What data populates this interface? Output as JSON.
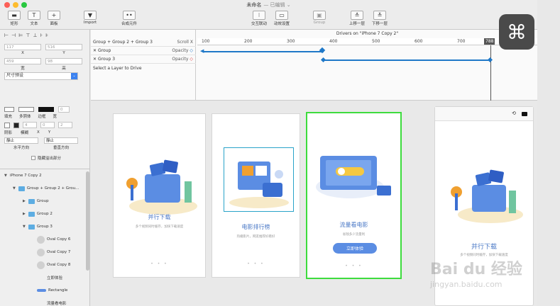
{
  "window": {
    "title": "未命名",
    "subtitle": "— 已编辑 ⌄"
  },
  "toolbar": {
    "items": [
      {
        "label": "矩形",
        "icon": "▬"
      },
      {
        "label": "文本",
        "icon": "T"
      },
      {
        "label": "面板",
        "icon": "+"
      },
      {
        "label": "Import",
        "icon": "▼"
      },
      {
        "label": "合成元件",
        "icon": "••"
      },
      {
        "label": "交互联动",
        "icon": "⁝"
      },
      {
        "label": "动效设置",
        "icon": "▭"
      },
      {
        "label": "Group",
        "icon": "▣"
      },
      {
        "label": "上移一层",
        "icon": "≛"
      },
      {
        "label": "下移一层",
        "icon": "≚"
      }
    ]
  },
  "inspector": {
    "x_value": "117",
    "y_value": "516",
    "x_label": "X",
    "y_label": "Y",
    "w_value": "459",
    "h_value": "98",
    "w_label": "宽",
    "h_label": "高",
    "size_preset": "尺寸预设",
    "fill_label": "填充",
    "stroke_label": "多阴体",
    "border_label": "边框",
    "width_label": "宽",
    "width_value": "0",
    "shadow_label": "阴影",
    "blur_label": "模糊",
    "sx_label": "X",
    "sy_label": "Y",
    "blur_value": "4",
    "sx_value": "0",
    "sy_value": "2",
    "h_align": "靜止",
    "v_align": "靜止",
    "h_align_label": "水平方向",
    "v_align_label": "垂直方向",
    "clip_label": "隐藏溢出部分"
  },
  "layers": [
    {
      "name": "iPhone 7 Copy 2",
      "type": "root",
      "indent": 0
    },
    {
      "name": "Group + Group 2 + Grou...",
      "type": "folder",
      "indent": 1
    },
    {
      "name": "Group",
      "type": "folder",
      "indent": 2
    },
    {
      "name": "Group 2",
      "type": "folder",
      "indent": 2
    },
    {
      "name": "Group 3",
      "type": "folder",
      "indent": 2
    },
    {
      "name": "Oval Copy 6",
      "type": "oval",
      "indent": 3
    },
    {
      "name": "Oval Copy 7",
      "type": "oval",
      "indent": 3
    },
    {
      "name": "Oval Copy 8",
      "type": "oval",
      "indent": 3
    },
    {
      "name": "立即体验",
      "type": "text",
      "indent": 3
    },
    {
      "name": "Rectangle",
      "type": "rect",
      "indent": 3
    },
    {
      "name": "流量看电影",
      "type": "text",
      "indent": 3
    }
  ],
  "timeline": {
    "header": "Drivers on \"iPhone 7 Copy 2\"",
    "driver_name": "Group + Group 2 + Group 3",
    "driver_prop": "Scroll X",
    "rows": [
      {
        "name": "Group",
        "prop": "Opacity"
      },
      {
        "name": "Group 3",
        "prop": "Opacity"
      }
    ],
    "hint": "Select a Layer to Drive",
    "ticks": [
      "100",
      "200",
      "300",
      "400",
      "500",
      "600",
      "700"
    ],
    "current": "788"
  },
  "cards": [
    {
      "title": "并行下载",
      "sub": "多个视频同时缓存，加快下载速度"
    },
    {
      "title": "电影排行榜",
      "sub": "热播影片，网友推荐好看好"
    },
    {
      "title": "流量看电影",
      "sub": "省钱多少流量利",
      "cta": "立即体验"
    }
  ],
  "preview": {
    "title": "并行下载",
    "sub": "多个视频同时缓存，加快下载速度"
  },
  "overlay": {
    "cmd": "⌘",
    "watermark": "Bai du 经验",
    "watermark_url": "jingyan.baidu.com"
  },
  "colors": {
    "accent": "#1f78c8",
    "selection": "#3ddc3d",
    "card_title": "#4a78c6"
  }
}
